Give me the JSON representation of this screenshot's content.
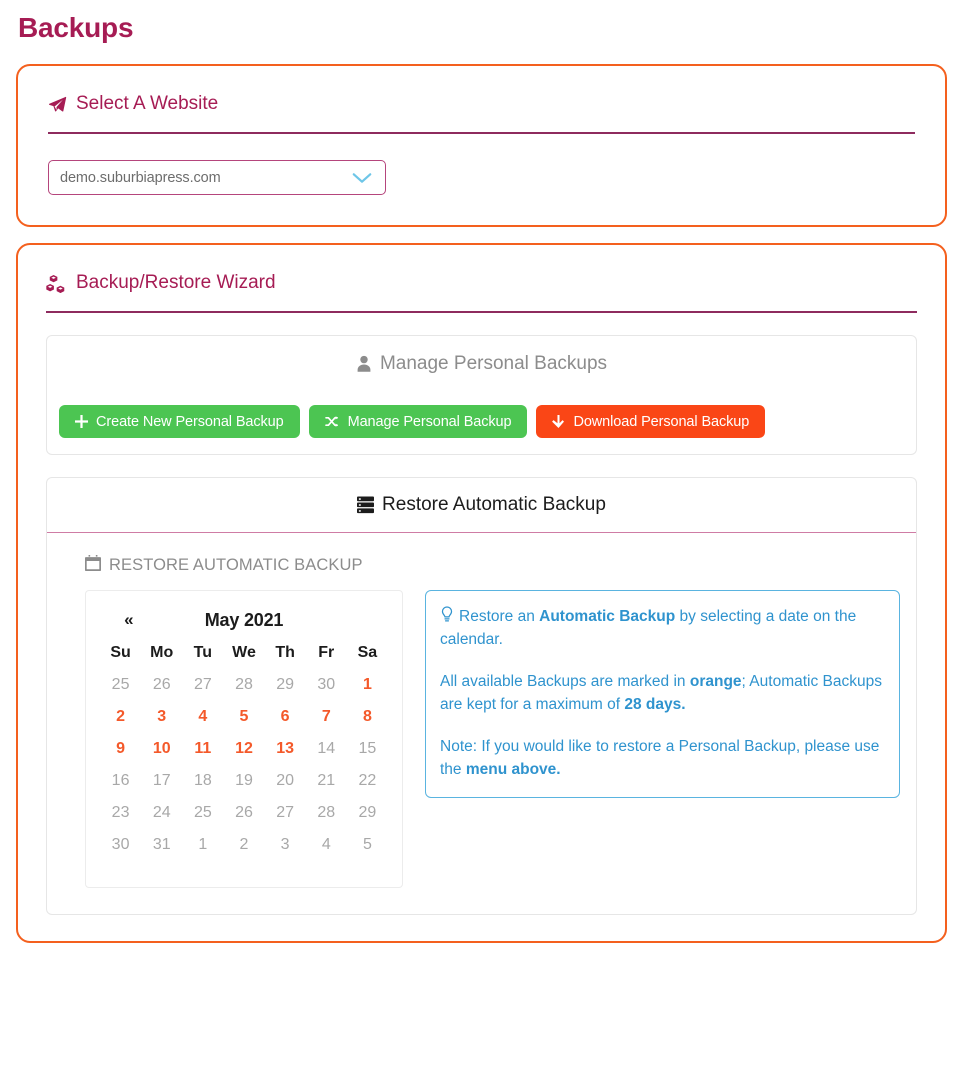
{
  "page": {
    "title": "Backups"
  },
  "theme": {
    "card_border": "#f4601e",
    "heading": "#a61c54",
    "green_button": "#4cc552",
    "orange_button": "#fa4616",
    "available_day": "#f4592a",
    "info_blue": "#2f93ce"
  },
  "website_card": {
    "heading": "Select A Website",
    "heading_icon": "paper-plane-icon",
    "select": {
      "value": "demo.suburbiapress.com",
      "icon": "chevron-down-icon"
    }
  },
  "wizard_card": {
    "heading": "Backup/Restore Wizard",
    "heading_icon": "boxes-icon",
    "personal_panel": {
      "tab_label": "Manage Personal Backups",
      "tab_icon": "user-icon",
      "tab_active": false,
      "buttons": [
        {
          "label": "Create New Personal Backup",
          "icon": "plus-icon",
          "style": "green"
        },
        {
          "label": "Manage Personal Backup",
          "icon": "shuffle-icon",
          "style": "green"
        },
        {
          "label": "Download Personal Backup",
          "icon": "arrow-down-icon",
          "style": "orange"
        }
      ]
    },
    "automatic_panel": {
      "tab_label": "Restore Automatic Backup",
      "tab_icon": "server-icon",
      "tab_active": true,
      "section_label": "RESTORE AUTOMATIC BACKUP",
      "section_icon": "calendar-icon",
      "calendar": {
        "prev_label": "«",
        "title": "May 2021",
        "weekdays": [
          "Su",
          "Mo",
          "Tu",
          "We",
          "Th",
          "Fr",
          "Sa"
        ],
        "weeks": [
          [
            {
              "day": "25",
              "available": false
            },
            {
              "day": "26",
              "available": false
            },
            {
              "day": "27",
              "available": false
            },
            {
              "day": "28",
              "available": false
            },
            {
              "day": "29",
              "available": false
            },
            {
              "day": "30",
              "available": false
            },
            {
              "day": "1",
              "available": true
            }
          ],
          [
            {
              "day": "2",
              "available": true
            },
            {
              "day": "3",
              "available": true
            },
            {
              "day": "4",
              "available": true
            },
            {
              "day": "5",
              "available": true
            },
            {
              "day": "6",
              "available": true
            },
            {
              "day": "7",
              "available": true
            },
            {
              "day": "8",
              "available": true
            }
          ],
          [
            {
              "day": "9",
              "available": true
            },
            {
              "day": "10",
              "available": true
            },
            {
              "day": "11",
              "available": true
            },
            {
              "day": "12",
              "available": true
            },
            {
              "day": "13",
              "available": true
            },
            {
              "day": "14",
              "available": false
            },
            {
              "day": "15",
              "available": false
            }
          ],
          [
            {
              "day": "16",
              "available": false
            },
            {
              "day": "17",
              "available": false
            },
            {
              "day": "18",
              "available": false
            },
            {
              "day": "19",
              "available": false
            },
            {
              "day": "20",
              "available": false
            },
            {
              "day": "21",
              "available": false
            },
            {
              "day": "22",
              "available": false
            }
          ],
          [
            {
              "day": "23",
              "available": false
            },
            {
              "day": "24",
              "available": false
            },
            {
              "day": "25",
              "available": false
            },
            {
              "day": "26",
              "available": false
            },
            {
              "day": "27",
              "available": false
            },
            {
              "day": "28",
              "available": false
            },
            {
              "day": "29",
              "available": false
            }
          ],
          [
            {
              "day": "30",
              "available": false
            },
            {
              "day": "31",
              "available": false
            },
            {
              "day": "1",
              "available": false
            },
            {
              "day": "2",
              "available": false
            },
            {
              "day": "3",
              "available": false
            },
            {
              "day": "4",
              "available": false
            },
            {
              "day": "5",
              "available": false
            }
          ]
        ]
      },
      "info": {
        "icon": "lightbulb-icon",
        "paragraphs": [
          [
            {
              "text": "Restore an ",
              "bold": false
            },
            {
              "text": "Automatic Backup",
              "bold": true
            },
            {
              "text": " by selecting a date on the calendar.",
              "bold": false
            }
          ],
          [
            {
              "text": "All available Backups are marked in ",
              "bold": false
            },
            {
              "text": "orange",
              "bold": true
            },
            {
              "text": "; Automatic Backups are kept for a maximum of ",
              "bold": false
            },
            {
              "text": "28 days.",
              "bold": true
            }
          ],
          [
            {
              "text": "Note: If you would like to restore a Personal Backup, please use the ",
              "bold": false
            },
            {
              "text": "menu above.",
              "bold": true
            }
          ]
        ]
      }
    }
  }
}
